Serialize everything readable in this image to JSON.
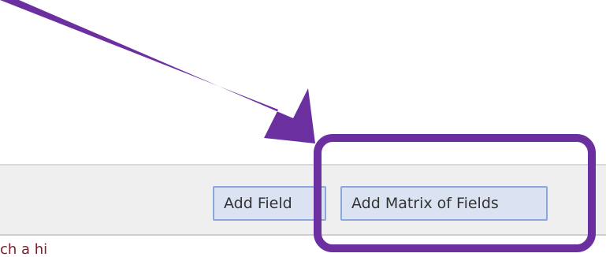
{
  "toolbar": {
    "add_field_label": "Add Field",
    "add_matrix_label": "Add Matrix of Fields"
  },
  "below_text": "ch a hi",
  "annotation": {
    "color": "#6b2fa0",
    "arrow": "pointing-arrow",
    "highlight": "rounded-rectangle"
  }
}
